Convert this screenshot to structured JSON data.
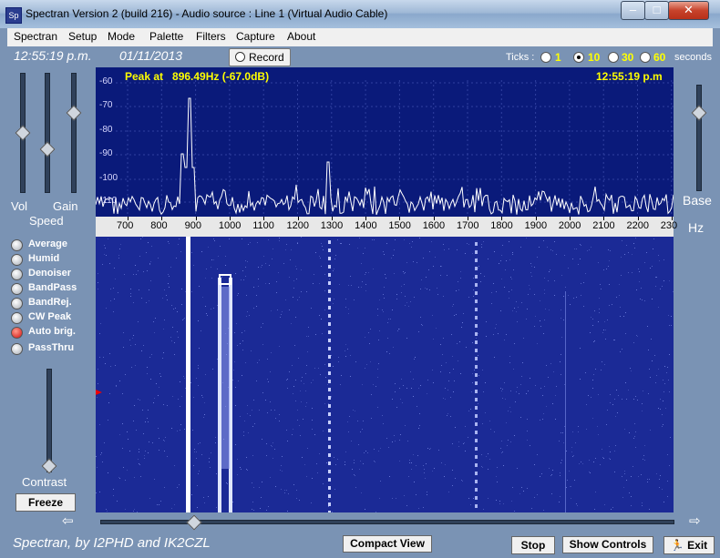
{
  "window": {
    "title": "Spectran Version 2 (build 216) - Audio source : Line 1 (Virtual Audio Cable)",
    "icon": "spectran-app-icon",
    "controls": {
      "minimize": "–",
      "maximize": "□",
      "close": "✕"
    }
  },
  "menu": [
    "Spectran",
    "Setup",
    "Mode",
    "Palette",
    "Filters",
    "Capture",
    "About"
  ],
  "status": {
    "time": "12:55:19 p.m.",
    "date": "01/11/2013",
    "record_label": "Record",
    "ticks_label": "Ticks :",
    "tick_options": [
      "1",
      "10",
      "30",
      "60"
    ],
    "tick_selected": "10",
    "ticks_unit": "seconds"
  },
  "spectrum": {
    "peak_label": "Peak at   896.49Hz (-67.0dB)",
    "peak_time": "12:55:19 p.m",
    "db_ticks": [
      "-60",
      "-70",
      "-80",
      "-90",
      "-100",
      "-110"
    ],
    "freq_ticks": [
      "700",
      "800",
      "900",
      "1000",
      "1100",
      "1200",
      "1300",
      "1400",
      "1500",
      "1600",
      "1700",
      "1800",
      "1900",
      "2000",
      "2100",
      "2200",
      "230"
    ],
    "peak_freq_hz": 896.49,
    "peak_db": -67.0
  },
  "left_panel": {
    "vol_label": "Vol",
    "gain_label": "Gain",
    "speed_label": "Speed",
    "options": [
      {
        "label": "Average",
        "on": false
      },
      {
        "label": "Humid",
        "on": false
      },
      {
        "label": "Denoiser",
        "on": false
      },
      {
        "label": "BandPass",
        "on": false
      },
      {
        "label": "BandRej.",
        "on": false
      },
      {
        "label": "CW Peak",
        "on": false
      },
      {
        "label": "Auto brig.",
        "on": true
      },
      {
        "label": "PassThru",
        "on": false
      }
    ],
    "contrast_label": "Contrast",
    "freeze_label": "Freeze"
  },
  "right_panel": {
    "base_label": "Base",
    "hz_label": "Hz"
  },
  "bottom": {
    "credit": "Spectran, by I2PHD and IK2CZL",
    "compact_view": "Compact View",
    "stop": "Stop",
    "show_controls": "Show Controls",
    "exit": "Exit"
  }
}
